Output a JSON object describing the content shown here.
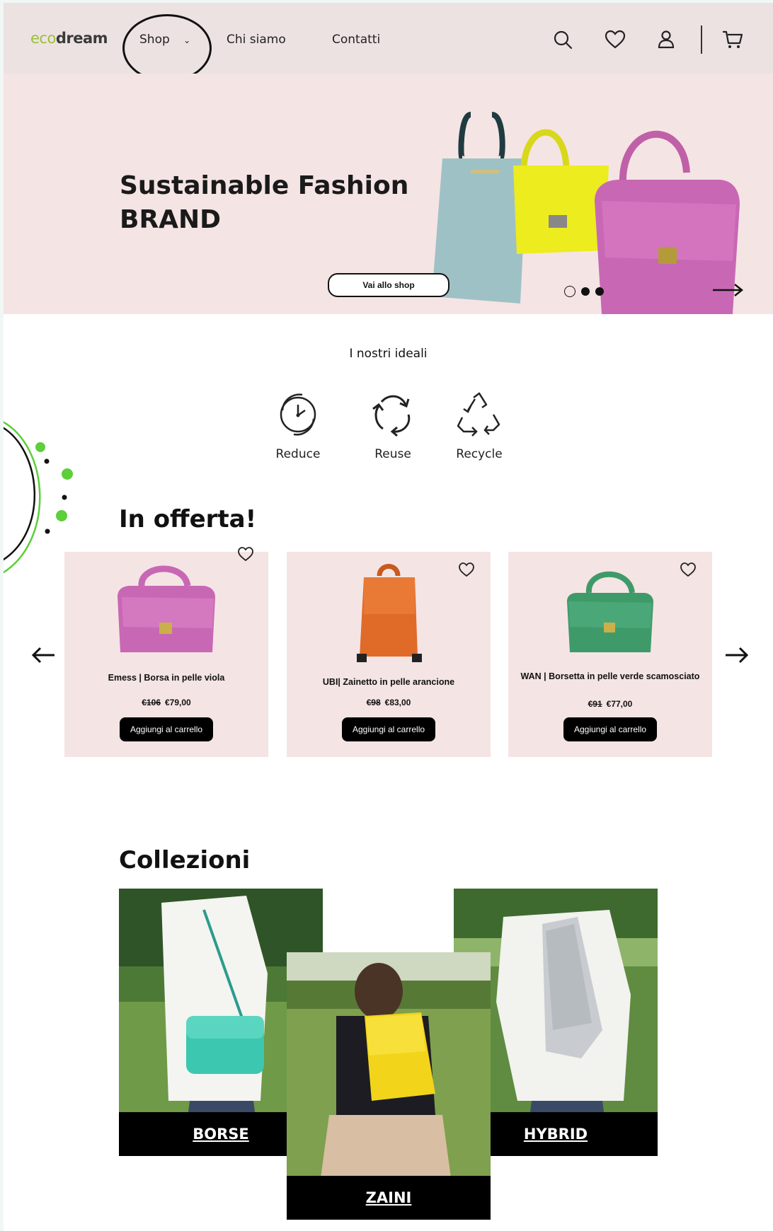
{
  "header": {
    "logo_eco": "eco",
    "logo_dream": "dream",
    "nav": [
      {
        "label": "Shop"
      },
      {
        "label": "Chi siamo"
      },
      {
        "label": "Contatti"
      }
    ],
    "icons": [
      "search-icon",
      "heart-icon",
      "user-icon",
      "cart-icon"
    ]
  },
  "hero": {
    "title_line1": "Sustainable Fashion",
    "title_line2": "BRAND",
    "button": "Vai allo shop",
    "carousel_active_index": 0,
    "carousel_count": 3
  },
  "ideals": {
    "title": "I nostri ideali",
    "items": [
      {
        "label": "Reduce",
        "icon": "clock-cycle-icon"
      },
      {
        "label": "Reuse",
        "icon": "reuse-arrows-icon"
      },
      {
        "label": "Recycle",
        "icon": "recycle-icon"
      }
    ]
  },
  "offers": {
    "title": "In offerta!",
    "products": [
      {
        "name": "Emess | Borsa in pelle viola",
        "old_price": "€106",
        "price": "€79,00",
        "button": "Aggiungi al carrello",
        "color": "#c868b4"
      },
      {
        "name": "UBI| Zainetto in pelle arancione",
        "old_price": "€98",
        "price": "€83,00",
        "button": "Aggiungi al carrello",
        "color": "#e06a28"
      },
      {
        "name": "WAN | Borsetta in pelle verde scamosciato",
        "old_price": "€91",
        "price": "€77,00",
        "button": "Aggiungi al carrello",
        "color": "#3f9a6a"
      }
    ]
  },
  "collections": {
    "title": "Collezioni",
    "items": [
      {
        "label": "BORSE",
        "bag_color": "#3cc7b0"
      },
      {
        "label": "ZAINI",
        "bag_color": "#f2d41a"
      },
      {
        "label": "HYBRID",
        "bag_color": "#c8ccd0"
      }
    ]
  },
  "colors": {
    "header_bg": "#ede2e2",
    "hero_bg": "#f5e4e4",
    "accent_green": "#9bbf3a",
    "deco_green": "#5ccf3a"
  }
}
